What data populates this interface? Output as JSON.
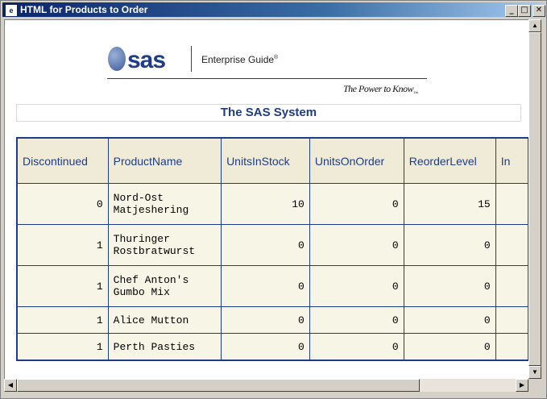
{
  "window": {
    "title": "HTML for Products to Order"
  },
  "logo": {
    "brand": "sas",
    "product": "Enterprise Guide",
    "registered": "®",
    "tagline": "The Power to Know",
    "trademark": "™"
  },
  "report": {
    "title": "The SAS System"
  },
  "table": {
    "headers": [
      "Discontinued",
      "ProductName",
      "UnitsInStock",
      "UnitsOnOrder",
      "ReorderLevel",
      "In"
    ],
    "rows": [
      {
        "discontinued": "0",
        "name_line1": "Nord-Ost",
        "name_line2": "Matjeshering",
        "units_in_stock": "10",
        "units_on_order": "0",
        "reorder_level": "15"
      },
      {
        "discontinued": "1",
        "name_line1": "Thuringer",
        "name_line2": "Rostbratwurst",
        "units_in_stock": "0",
        "units_on_order": "0",
        "reorder_level": "0"
      },
      {
        "discontinued": "1",
        "name_line1": "Chef Anton's",
        "name_line2": "Gumbo Mix",
        "units_in_stock": "0",
        "units_on_order": "0",
        "reorder_level": "0"
      },
      {
        "discontinued": "1",
        "name_line1": "Alice Mutton",
        "name_line2": "",
        "units_in_stock": "0",
        "units_on_order": "0",
        "reorder_level": "0"
      },
      {
        "discontinued": "1",
        "name_line1": "Perth Pasties",
        "name_line2": "",
        "units_in_stock": "0",
        "units_on_order": "0",
        "reorder_level": "0"
      }
    ]
  },
  "colors": {
    "accent": "#1f3c88",
    "header_bg": "#efebd7",
    "cell_bg": "#f7f5e6",
    "titlebar": "#0a246a"
  }
}
